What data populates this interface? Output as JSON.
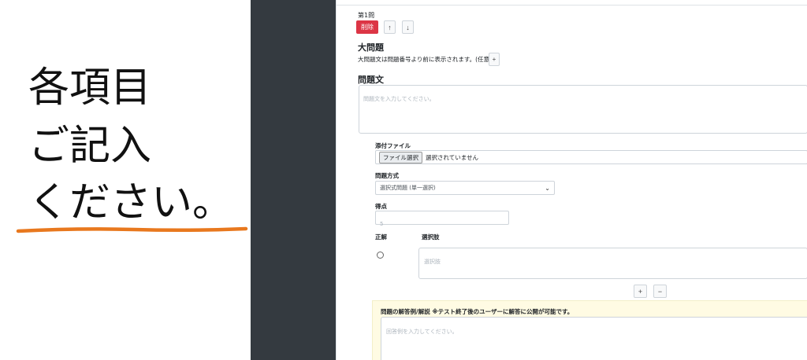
{
  "callout": {
    "line1": "各項目",
    "line2": "ご記入",
    "line3": "ください。",
    "underline_color": "#e8781e"
  },
  "form": {
    "question_number": "第1問",
    "delete_label": "削除",
    "move_up_label": "↑",
    "move_down_label": "↓",
    "major_heading": "大問題",
    "major_description": "大問題文は問題番号より前に表示されます。(任意)",
    "major_add_label": "+",
    "question_heading": "問題文",
    "question_placeholder": "問題文を入力してください。",
    "attachment_label": "添付ファイル",
    "file_button_label": "ファイル選択",
    "file_status": "選択されていません",
    "method_label": "問題方式",
    "method_selected": "選択式問題 (単一選択)",
    "score_label": "得点",
    "score_placeholder": "5",
    "correct_label": "正解",
    "choices_label": "選択肢",
    "choice_placeholder": "選択肢",
    "add_choice_label": "+",
    "remove_choice_label": "−",
    "explanation_label": "問題の解答例/解説 ※テスト終了後のユーザーに解答に公開が可能です。",
    "explanation_placeholder": "回答例を入力してください。"
  },
  "colors": {
    "delete": "#dc3545",
    "sidebar": "#343a40",
    "explanation_bg": "#fffbe3"
  }
}
